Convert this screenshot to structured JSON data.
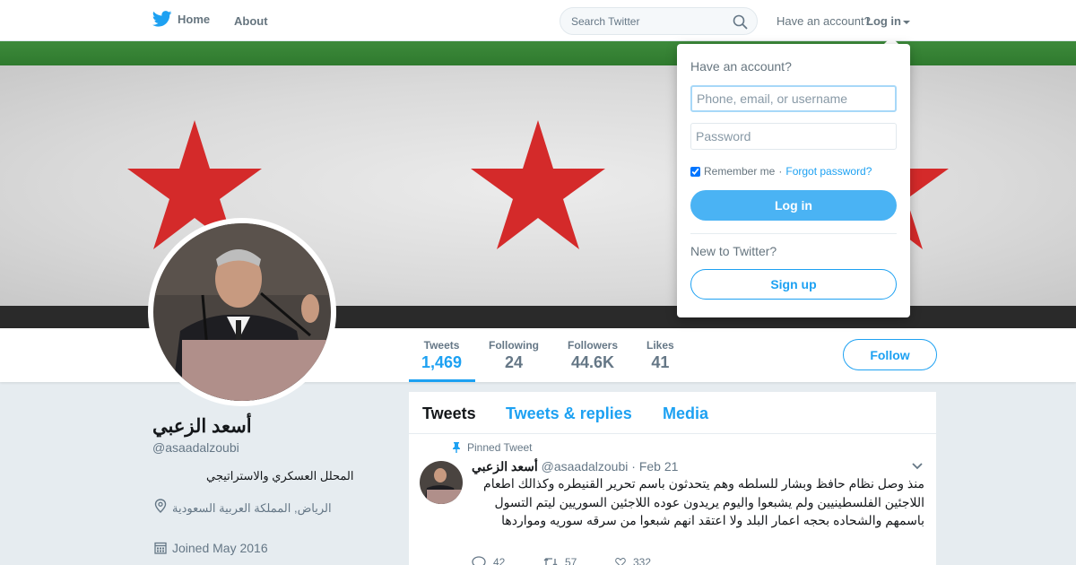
{
  "nav": {
    "home_label": "Home",
    "about_label": "About",
    "search_placeholder": "Search Twitter",
    "have_account_text": "Have an account?",
    "login_label": "Log in"
  },
  "profile": {
    "name": "أسعد الزعبي",
    "handle": "@asaadalzoubi",
    "bio": "المحلل العسكري والاستراتيجي",
    "location": "الرياض, المملكة العربية السعودية",
    "joined": "Joined May 2016",
    "follow_label": "Follow"
  },
  "stats": [
    {
      "label": "Tweets",
      "value": "1,469"
    },
    {
      "label": "Following",
      "value": "24"
    },
    {
      "label": "Followers",
      "value": "44.6K"
    },
    {
      "label": "Likes",
      "value": "41"
    }
  ],
  "timeline": {
    "tabs": [
      "Tweets",
      "Tweets & replies",
      "Media"
    ],
    "pinned_label": "Pinned Tweet",
    "tweet": {
      "name": "أسعد الزعبي",
      "handle": "@asaadalzoubi",
      "separator": "·",
      "date": "Feb 21",
      "text": "منذ وصل نظام حافظ وبشار للسلطه وهم يتحدثون باسم تحرير القنيطره وكذالك اطعام اللاجئين الفلسطينيين ولم يشبعوا واليوم يريدون عوده اللاجئين السوريين ليتم التسول باسمهم والشحاده بحجه اعمار البلد ولا اعتقد انهم شبعوا من سرقه سوريه ومواردها",
      "replies": "42",
      "retweets": "57",
      "likes": "332"
    }
  },
  "login_dropdown": {
    "title": "Have an account?",
    "username_placeholder": "Phone, email, or username",
    "password_placeholder": "Password",
    "remember_label": "Remember me",
    "separator": "·",
    "forgot_label": "Forgot password?",
    "login_button": "Log in",
    "new_text": "New to Twitter?",
    "signup_button": "Sign up"
  },
  "colors": {
    "accent": "#1da1f2",
    "flag_green": "#3d8a3b",
    "flag_red": "#d42a2a",
    "flag_black": "#2a2a2a"
  }
}
